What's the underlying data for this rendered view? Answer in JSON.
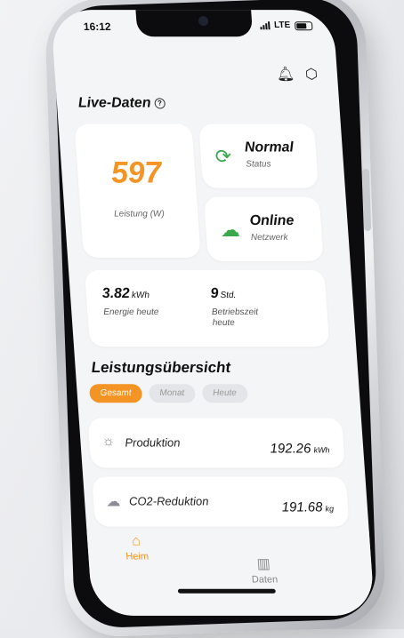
{
  "status_bar": {
    "time": "16:12",
    "network": "LTE"
  },
  "header": {
    "icons": [
      "bell-icon",
      "settings-hex-icon"
    ]
  },
  "live": {
    "title": "Live-Daten",
    "power_value": "597",
    "power_label": "Leistung (W)",
    "status_value": "Normal",
    "status_label": "Status",
    "network_value": "Online",
    "network_label": "Netzwerk",
    "energy_value": "3.82",
    "energy_unit": "kWh",
    "energy_label": "Energie heute",
    "runtime_value": "9",
    "runtime_unit": "Std.",
    "runtime_label": "Betriebszeit heute"
  },
  "overview": {
    "title": "Leistungsübersicht",
    "tabs": [
      {
        "label": "Gesamt",
        "active": true
      },
      {
        "label": "Monat",
        "active": false
      },
      {
        "label": "Heute",
        "active": false
      }
    ],
    "rows": [
      {
        "label": "Produktion",
        "value": "192.26",
        "unit": "kWh",
        "icon": "sun-icon"
      },
      {
        "label": "CO2-Reduktion",
        "value": "191.68",
        "unit": "kg",
        "icon": "cloud-icon"
      }
    ]
  },
  "nav": {
    "home": "Heim",
    "data": "Daten"
  },
  "colors": {
    "accent": "#f39424",
    "ok_green": "#3aa84a"
  }
}
